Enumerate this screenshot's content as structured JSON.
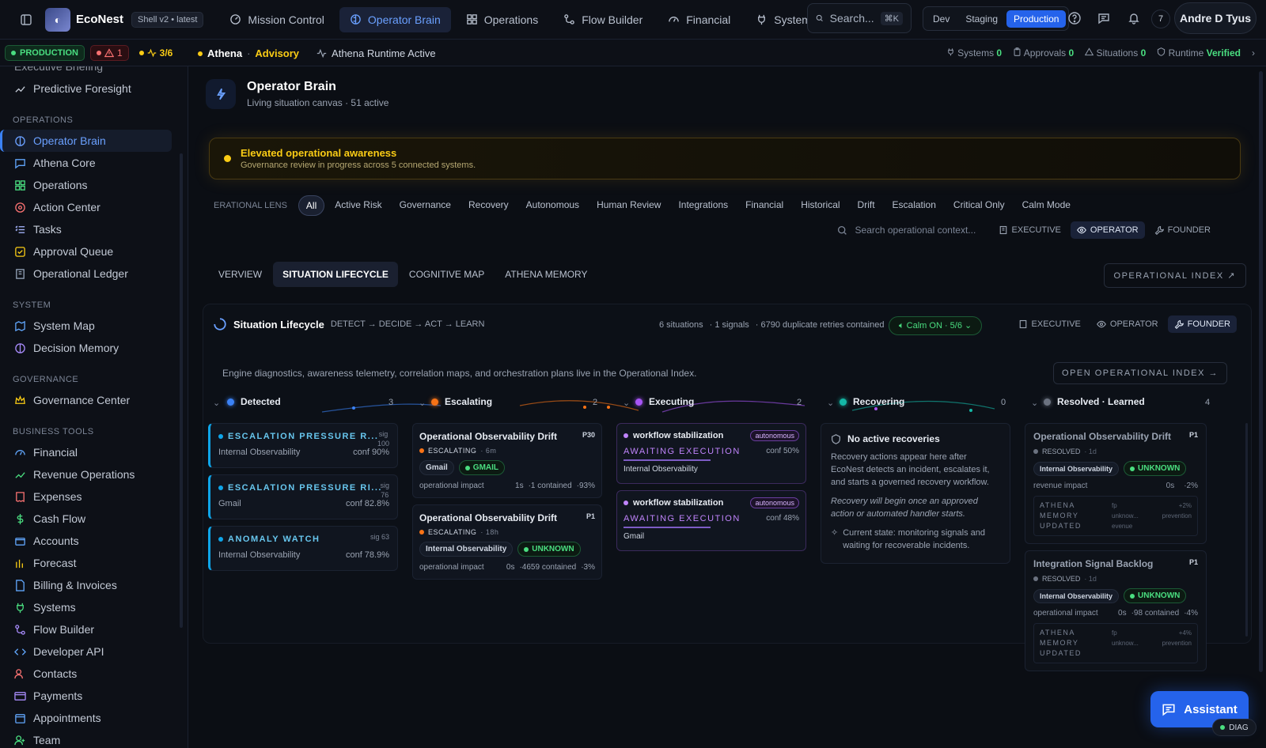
{
  "topbar": {
    "brand": "EcoNest",
    "shell": "Shell v2 • latest",
    "nav": [
      "Mission Control",
      "Operator Brain",
      "Operations",
      "Flow Builder",
      "Financial",
      "Systems"
    ],
    "search": "Search...",
    "kbd": "⌘K",
    "envs": [
      "Dev",
      "Staging",
      "Production"
    ],
    "notif_count": "7",
    "user": "Andre D Tyus"
  },
  "subbar": {
    "production": "PRODUCTION",
    "warn_count": "1",
    "pulse": "3/6",
    "ctx_name": "Athena",
    "ctx_sep": "·",
    "ctx_mode": "Advisory",
    "runtime": "Athena Runtime Active",
    "stats": [
      {
        "label": "Systems",
        "value": "0"
      },
      {
        "label": "Approvals",
        "value": "0"
      },
      {
        "label": "Situations",
        "value": "0"
      },
      {
        "label": "Runtime",
        "value": "Verified"
      }
    ]
  },
  "sidebar": {
    "top_partial": "Executive Briefing",
    "top_item": "Predictive Foresight",
    "sections": [
      {
        "title": "OPERATIONS",
        "items": [
          "Operator Brain",
          "Athena Core",
          "Operations",
          "Action Center",
          "Tasks",
          "Approval Queue",
          "Operational Ledger"
        ]
      },
      {
        "title": "SYSTEM",
        "items": [
          "System Map",
          "Decision Memory"
        ]
      },
      {
        "title": "GOVERNANCE",
        "items": [
          "Governance Center"
        ]
      },
      {
        "title": "BUSINESS TOOLS",
        "items": [
          "Financial",
          "Revenue Operations",
          "Expenses",
          "Cash Flow",
          "Accounts",
          "Forecast",
          "Billing & Invoices",
          "Systems",
          "Flow Builder",
          "Developer API",
          "Contacts",
          "Payments",
          "Appointments",
          "Team"
        ]
      }
    ]
  },
  "header": {
    "title": "Operator Brain",
    "subtitle": "Living situation canvas · 51 active"
  },
  "alert": {
    "title": "Elevated operational awareness",
    "sub": "Governance review in progress across 5 connected systems."
  },
  "lens": {
    "label": "ERATIONAL LENS",
    "items": [
      "All",
      "Active Risk",
      "Governance",
      "Recovery",
      "Autonomous",
      "Human Review",
      "Integrations",
      "Financial",
      "Historical",
      "Drift",
      "Escalation",
      "Critical Only",
      "Calm Mode"
    ]
  },
  "persp": {
    "search": "Search operational context...",
    "items": [
      "EXECUTIVE",
      "OPERATOR",
      "FOUNDER"
    ]
  },
  "tabs": [
    "VERVIEW",
    "SITUATION LIFECYCLE",
    "COGNITIVE MAP",
    "ATHENA MEMORY"
  ],
  "oi_btn": "OPERATIONAL INDEX ↗",
  "lifecycle": {
    "title": "Situation Lifecycle",
    "flow": "DETECT → DECIDE → ACT → LEARN",
    "stats": [
      "6 situations",
      "· 1 signals",
      "· 6790 duplicate retries contained"
    ],
    "calm": "Calm ON · 5/6",
    "persp": [
      "EXECUTIVE",
      "OPERATOR",
      "FOUNDER"
    ],
    "note": "Engine diagnostics, awareness telemetry, correlation maps, and orchestration plans live in the Operational Index.",
    "open_oi": "OPEN OPERATIONAL INDEX →",
    "stages": [
      {
        "name": "Detected",
        "count": "3",
        "color": "#3b82f6"
      },
      {
        "name": "Escalating",
        "count": "2",
        "color": "#f97316"
      },
      {
        "name": "Executing",
        "count": "2",
        "color": "#a855f7"
      },
      {
        "name": "Recovering",
        "count": "0",
        "color": "#14b8a6"
      },
      {
        "name": "Resolved · Learned",
        "count": "4",
        "color": "#6b7280"
      }
    ],
    "detected": [
      {
        "title": "ESCALATION PRESSURE R...",
        "sig": "sig",
        "sig_n": "100",
        "src": "Internal Observability",
        "conf": "conf 90%"
      },
      {
        "title": "ESCALATION PRESSURE RI...",
        "sig": "sig",
        "sig_n": "76",
        "src": "Gmail",
        "conf": "conf 82.8%"
      },
      {
        "title": "ANOMALY WATCH",
        "sig": "sig 63",
        "sig_n": "",
        "src": "Internal Observability",
        "conf": "conf 78.9%"
      }
    ],
    "escalating": [
      {
        "title": "Operational Observability Drift",
        "pri": "P30",
        "status": "ESCALATING",
        "age": "· 6m",
        "src": "Gmail",
        "chip": "GMAIL",
        "impact": "operational impact",
        "m1": "1s",
        "m2": "·1 contained",
        "m3": "·93%"
      },
      {
        "title": "Operational Observability Drift",
        "pri": "P1",
        "status": "ESCALATING",
        "age": "· 18h",
        "src": "Internal Observability",
        "chip": "UNKNOWN",
        "impact": "operational impact",
        "m1": "0s",
        "m2": "·4659 contained",
        "m3": "·3%"
      }
    ],
    "executing": [
      {
        "title": "workflow stabilization",
        "badge": "autonomous",
        "status": "AWAITING EXECUTION",
        "conf": "conf 50%",
        "src": "Internal Observability"
      },
      {
        "title": "workflow stabilization",
        "badge": "autonomous",
        "status": "AWAITING EXECUTION",
        "conf": "conf 48%",
        "src": "Gmail"
      }
    ],
    "recovering": {
      "title": "No active recoveries",
      "p1": "Recovery actions appear here after EcoNest detects an incident, escalates it, and starts a governed recovery workflow.",
      "p2": "Recovery will begin once an approved action or automated handler starts.",
      "p3": "Current state: monitoring signals and waiting for recoverable incidents."
    },
    "resolved": [
      {
        "title": "Operational Observability Drift",
        "pri": "P1",
        "status": "RESOLVED",
        "age": "· 1d",
        "src": "Internal Observability",
        "chip": "UNKNOWN",
        "impact": "revenue impact",
        "m1": "0s",
        "m2": "",
        "m3": "·2%",
        "mem": "ATHENA MEMORY UPDATED",
        "fp": "fp unknow... evenue",
        "prev": "+2% prevention"
      },
      {
        "title": "Integration Signal Backlog",
        "pri": "P1",
        "status": "RESOLVED",
        "age": "· 1d",
        "src": "Internal Observability",
        "chip": "UNKNOWN",
        "impact": "operational impact",
        "m1": "0s",
        "m2": "·98 contained",
        "m3": "·4%",
        "mem": "ATHENA MEMORY UPDATED",
        "fp": "fp unknow...",
        "prev": "+4% prevention"
      }
    ]
  },
  "assistant": "Assistant",
  "diag": "DIAG",
  "colors": {
    "accent": "#2563eb",
    "production": "#4ade80",
    "warning": "#facc15",
    "danger": "#f87171",
    "executing": "#a855f7"
  }
}
